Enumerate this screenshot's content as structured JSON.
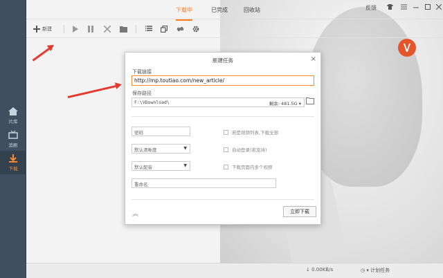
{
  "sidebar": {
    "items": [
      {
        "label": "片库",
        "icon": "home-icon"
      },
      {
        "label": "追剧",
        "icon": "tv-icon"
      },
      {
        "label": "下载",
        "icon": "download-icon"
      }
    ]
  },
  "tabs": [
    {
      "label": "下载中"
    },
    {
      "label": "已完成"
    },
    {
      "label": "回收站"
    }
  ],
  "window": {
    "feedback": "反馈",
    "skin_icon": "shirt-icon",
    "menu_icon": "menu-icon",
    "min_icon": "minimize-icon",
    "max_icon": "maximize-icon",
    "close_icon": "close-icon"
  },
  "toolbar": {
    "new_label": "新建"
  },
  "dialog": {
    "title": "新建任务",
    "url_label": "下载链接",
    "url_value": "http://mp.toutiao.com/new_article/",
    "save_path_label": "保存路径",
    "save_path_value": "F:\\VDownload\\",
    "space_label": "剩余:",
    "space_value": "481.5G",
    "password_placeholder": "密码",
    "clarity_select": "默认清晰度",
    "audio_select": "默认配音",
    "rename_placeholder": "重命名",
    "option_playlist": "若是视频列表,下载全部",
    "option_auto_login": "自动登录(若支持)",
    "option_multi_video": "下载页面内多个视频",
    "download_button": "立即下载"
  },
  "status": {
    "speed": "0.00KB/s",
    "schedule": "计划任务"
  },
  "colors": {
    "accent": "#ff7a1a",
    "arrow": "#e43a2f",
    "sidebar": "#3f4f5f"
  }
}
